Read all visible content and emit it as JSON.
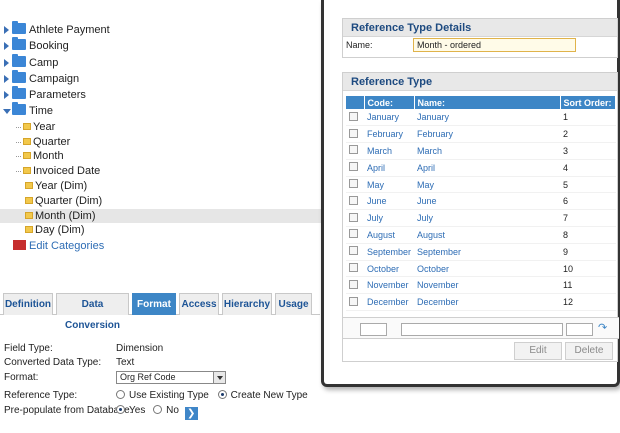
{
  "tree": {
    "top_items": [
      {
        "label": "Athlete Payment"
      },
      {
        "label": "Booking"
      },
      {
        "label": "Camp"
      },
      {
        "label": "Campaign"
      },
      {
        "label": "Parameters"
      }
    ],
    "time": {
      "label": "Time",
      "children": [
        {
          "label": "Year"
        },
        {
          "label": "Quarter"
        },
        {
          "label": "Month"
        },
        {
          "label": "Invoiced Date"
        }
      ],
      "grandchildren": [
        {
          "label": "Year (Dim)"
        },
        {
          "label": "Quarter (Dim)"
        },
        {
          "label": "Month (Dim)"
        },
        {
          "label": "Day (Dim)"
        }
      ]
    },
    "edit_categories": "Edit Categories"
  },
  "tabs": [
    "Definition",
    "Data Conversion",
    "Format",
    "Access",
    "Hierarchy",
    "Usage"
  ],
  "active_tab": "Format",
  "form": {
    "field_type_label": "Field Type:",
    "field_type_value": "Dimension",
    "converted_label": "Converted Data Type:",
    "converted_value": "Text",
    "format_label": "Format:",
    "format_value": "Org Ref Code",
    "ref_type_label": "Reference Type:",
    "ref_opt1": "Use Existing Type",
    "ref_opt2": "Create New Type",
    "prepop_label": "Pre-populate from Database:",
    "yes": "Yes",
    "no": "No"
  },
  "dialog": {
    "details_title": "Reference Type Details",
    "name_label": "Name:",
    "name_value": "Month - ordered",
    "ref_type_title": "Reference Type",
    "columns": [
      "Code:",
      "Name:",
      "Sort Order:"
    ],
    "rows": [
      {
        "code": "January",
        "name": "January",
        "order": "1"
      },
      {
        "code": "February",
        "name": "February",
        "order": "2"
      },
      {
        "code": "March",
        "name": "March",
        "order": "3"
      },
      {
        "code": "April",
        "name": "April",
        "order": "4"
      },
      {
        "code": "May",
        "name": "May",
        "order": "5"
      },
      {
        "code": "June",
        "name": "June",
        "order": "6"
      },
      {
        "code": "July",
        "name": "July",
        "order": "7"
      },
      {
        "code": "August",
        "name": "August",
        "order": "8"
      },
      {
        "code": "September",
        "name": "September",
        "order": "9"
      },
      {
        "code": "October",
        "name": "October",
        "order": "10"
      },
      {
        "code": "November",
        "name": "November",
        "order": "11"
      },
      {
        "code": "December",
        "name": "December",
        "order": "12"
      }
    ],
    "edit_label": "Edit",
    "delete_label": "Delete"
  },
  "colors": {
    "accent": "#3d86c6",
    "link": "#2e6db5",
    "folder": "#3b86d6"
  }
}
